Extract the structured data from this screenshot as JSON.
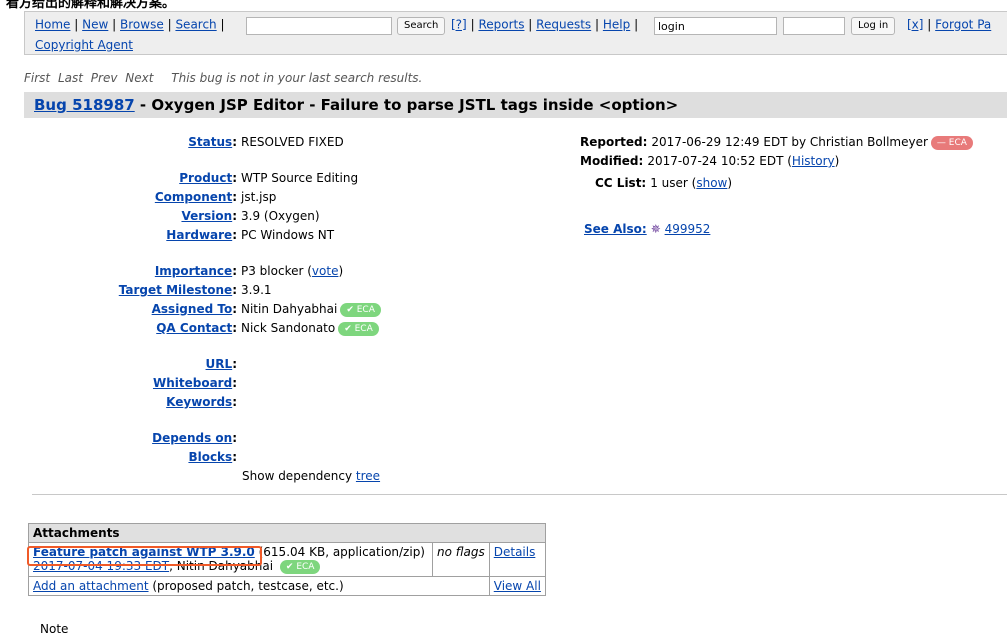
{
  "caption": "看方给出的解释和解决方案。",
  "nav": {
    "home": "Home",
    "new": "New",
    "browse": "Browse",
    "search": "Search",
    "search_button": "Search",
    "help_q": "[?]",
    "reports": "Reports",
    "requests": "Requests",
    "help": "Help",
    "login_value": "login",
    "login_button": "Log in",
    "close_x": "[x]",
    "forgot": "Forgot Pa",
    "copyright": "Copyright Agent"
  },
  "search_nav": {
    "first": "First",
    "last": "Last",
    "prev": "Prev",
    "next": "Next",
    "message": "This bug is not in your last search results."
  },
  "bug": {
    "link": "Bug 518987",
    "title": " - Oxygen JSP Editor - Failure to parse JSTL tags inside <option>"
  },
  "fields": {
    "status_label": "Status",
    "status": "RESOLVED FIXED",
    "product_label": "Product",
    "product": "WTP Source Editing",
    "component_label": "Component",
    "component": "jst.jsp",
    "version_label": "Version",
    "version": "3.9 (Oxygen)",
    "hardware_label": "Hardware",
    "hardware": "PC Windows NT",
    "importance_label": "Importance",
    "importance": "P3 blocker (",
    "vote": "vote",
    "importance_end": ")",
    "milestone_label": "Target Milestone",
    "milestone": "3.9.1",
    "assigned_label": "Assigned To",
    "assigned": "Nitin Dahyabhai",
    "qa_label": "QA Contact",
    "qa": "Nick Sandonato",
    "url_label": "URL",
    "whiteboard_label": "Whiteboard",
    "keywords_label": "Keywords",
    "depends_label": "Depends on",
    "blocks_label": "Blocks",
    "dep_text": "Show dependency ",
    "dep_link": "tree",
    "eca": "ECA"
  },
  "right": {
    "reported_label": "Reported:",
    "reported": "2017-06-29 12:49 EDT by Christian Bollmeyer",
    "modified_label": "Modified:",
    "modified": "2017-07-24 10:52 EDT (",
    "history": "History",
    "modified_end": ")",
    "cc_label": "CC List:",
    "cc": "1 user (",
    "show": "show",
    "cc_end": ")",
    "see_also_label": "See Also:",
    "see_also": "499952"
  },
  "attachments": {
    "header": "Attachments",
    "name": "Feature patch against WTP 3.9.0",
    "meta": "(615.04 KB, application/zip)",
    "date": "2017-07-04 19:33 EDT",
    "author": ", Nitin Dahyabhai",
    "flags": "no flags",
    "details": "Details",
    "add": "Add an attachment",
    "add_note": " (proposed patch, testcase, etc.)",
    "view_all": "View All"
  },
  "note": "Note"
}
